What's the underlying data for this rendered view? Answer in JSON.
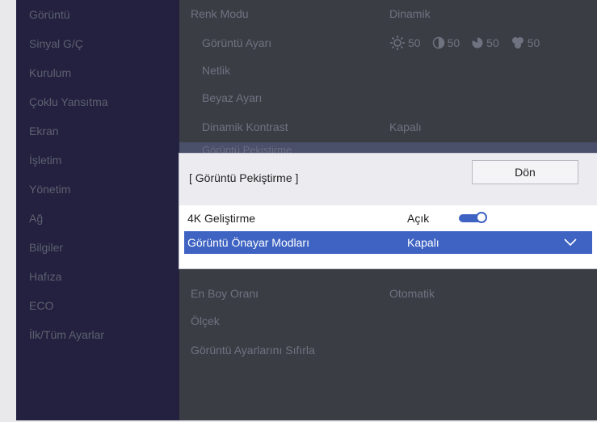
{
  "sidebar": {
    "items": [
      {
        "label": "Görüntü"
      },
      {
        "label": "Sinyal G/Ç"
      },
      {
        "label": "Kurulum"
      },
      {
        "label": "Çoklu Yansıtma"
      },
      {
        "label": "Ekran"
      },
      {
        "label": "İşletim"
      },
      {
        "label": "Yönetim"
      },
      {
        "label": "Ağ"
      },
      {
        "label": "Bilgiler"
      },
      {
        "label": "Hafıza"
      },
      {
        "label": "ECO"
      },
      {
        "label": "İlk/Tüm Ayarlar"
      }
    ]
  },
  "main": {
    "color_mode": {
      "label": "Renk Modu",
      "value": "Dinamik"
    },
    "picture_adjust": {
      "label": "Görüntü Ayarı",
      "brightness": "50",
      "contrast": "50",
      "saturation": "50",
      "tint": "50"
    },
    "sharpness": {
      "label": "Netlik"
    },
    "white_balance": {
      "label": "Beyaz Ayarı"
    },
    "dynamic_contrast": {
      "label": "Dinamik Kontrast",
      "value": "Kapalı"
    },
    "peek_label": "Görüntü Pekiştirme",
    "aspect": {
      "label": "En Boy Oranı",
      "value": "Otomatik"
    },
    "scale": {
      "label": "Ölçek"
    },
    "reset": {
      "label": "Görüntü Ayarlarını Sıfırla"
    }
  },
  "dialog": {
    "title": "[ Görüntü Pekiştirme ]",
    "back_label": "Dön",
    "rows": [
      {
        "label": "4K Geliştirme",
        "value": "Açık",
        "toggle_on": true
      },
      {
        "label": "Görüntü Önayar Modları",
        "value": "Kapalı"
      }
    ]
  },
  "colors": {
    "sidebar_bg": "#23213f",
    "main_bg": "#3b3d45",
    "accent": "#3e63c2",
    "dialog_bg": "#ffffff"
  },
  "icons": [
    "brightness-icon",
    "contrast-icon",
    "saturation-icon",
    "tint-icon",
    "chevron-down-icon"
  ]
}
